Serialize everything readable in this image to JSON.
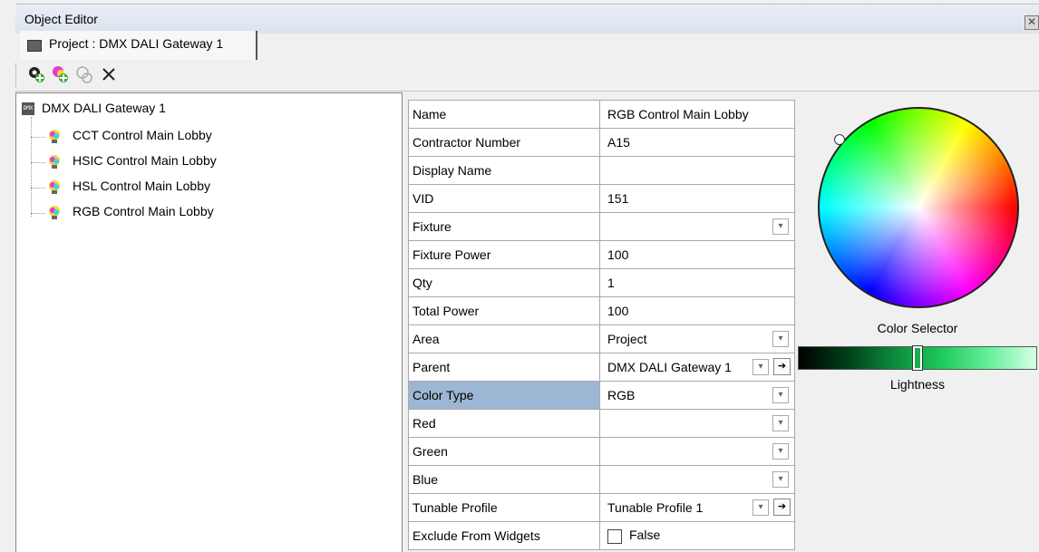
{
  "window": {
    "title": "Object Editor",
    "close_glyph": "✕"
  },
  "tab": {
    "label": "Project : DMX DALI Gateway 1"
  },
  "toolbar": {
    "buttons": [
      "add-fixture-icon",
      "add-group-icon",
      "disabled-fixture-icon",
      "delete-icon"
    ]
  },
  "tree": {
    "root": {
      "icon": "DMX",
      "label": "DMX DALI Gateway 1"
    },
    "children": [
      {
        "label": "CCT Control Main Lobby"
      },
      {
        "label": "HSIC Control Main Lobby"
      },
      {
        "label": "HSL Control Main Lobby"
      },
      {
        "label": "RGB Control Main Lobby"
      }
    ]
  },
  "properties": [
    {
      "name": "Name",
      "value": "RGB Control Main Lobby"
    },
    {
      "name": "Contractor Number",
      "value": "A15"
    },
    {
      "name": "Display Name",
      "value": ""
    },
    {
      "name": "VID",
      "value": "151"
    },
    {
      "name": "Fixture",
      "value": ""
    },
    {
      "name": "Fixture Power",
      "value": "100"
    },
    {
      "name": "Qty",
      "value": "1"
    },
    {
      "name": "Total Power",
      "value": "100"
    },
    {
      "name": "Area",
      "value": "Project"
    },
    {
      "name": "Parent",
      "value": "DMX DALI Gateway 1"
    },
    {
      "name": "Color Type",
      "value": "RGB"
    },
    {
      "name": "Red",
      "value": ""
    },
    {
      "name": "Green",
      "value": ""
    },
    {
      "name": "Blue",
      "value": ""
    },
    {
      "name": "Tunable Profile",
      "value": "Tunable Profile 1"
    },
    {
      "name": "Exclude From Widgets",
      "value": "False"
    }
  ],
  "color_selector": {
    "label": "Color Selector",
    "lightness_label": "Lightness"
  },
  "colors": {
    "selected_row": "#9db6d3",
    "title_bar": "#dbe3ee"
  }
}
